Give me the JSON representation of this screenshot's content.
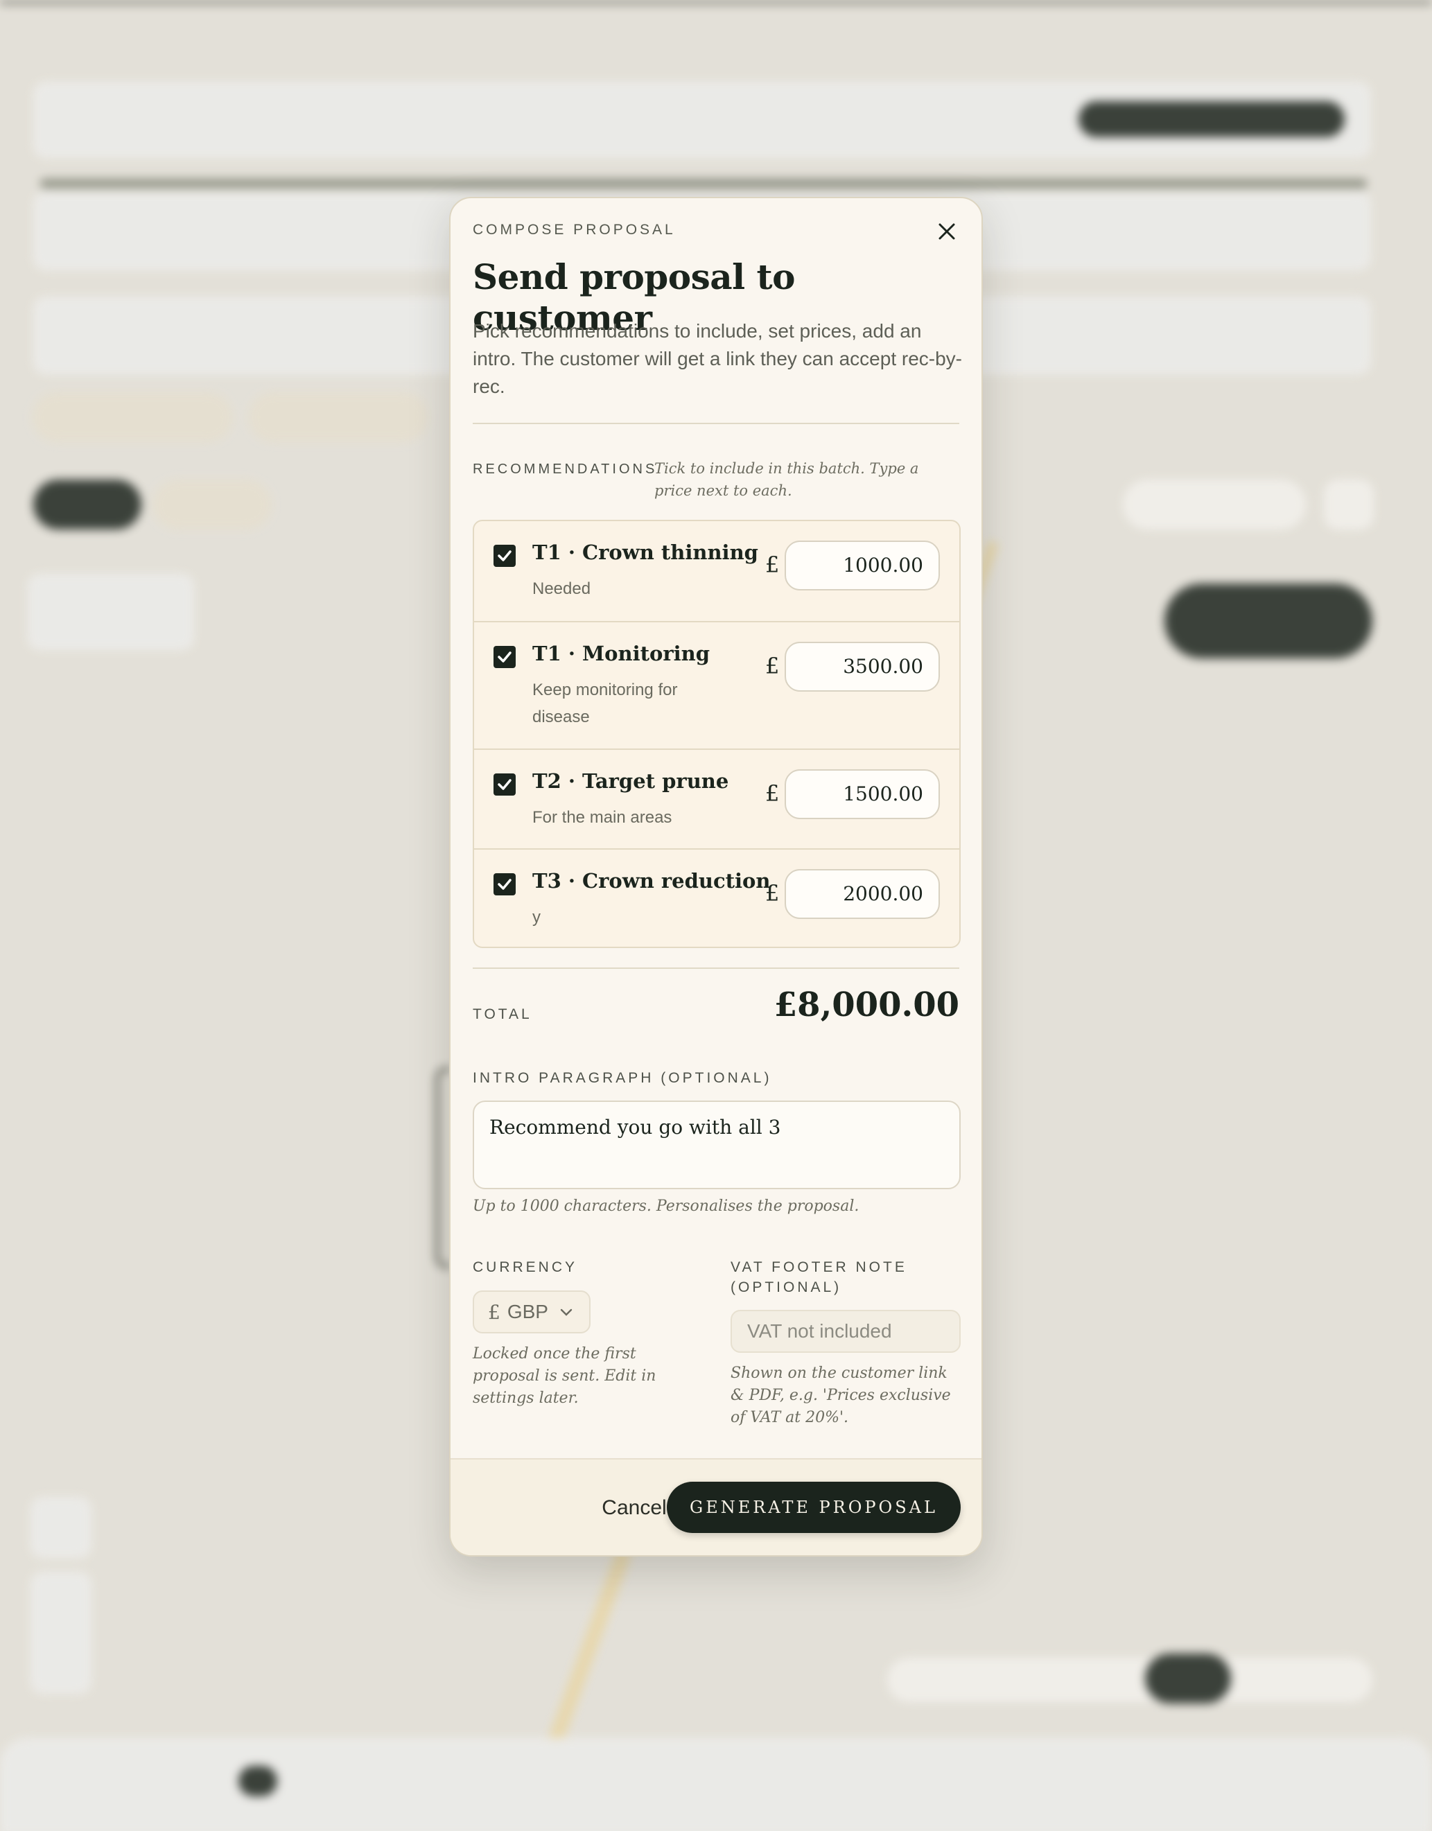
{
  "modal": {
    "eyebrow": "COMPOSE PROPOSAL",
    "title": "Send proposal to customer",
    "description": "Pick recommendations to include, set prices, add an intro. The customer will get a link they can accept rec-by-rec.",
    "close_icon": "close-icon"
  },
  "recommendations": {
    "label": "RECOMMENDATIONS",
    "hint": "Tick to include in this batch. Type a price next to each.",
    "currency_symbol": "£",
    "items": [
      {
        "name": "T1 · Crown thinning",
        "note": "Needed",
        "price": "1000.00",
        "checked": true
      },
      {
        "name": "T1 · Monitoring",
        "note": "Keep monitoring for disease",
        "price": "3500.00",
        "checked": true
      },
      {
        "name": "T2 · Target prune",
        "note": "For the main areas",
        "price": "1500.00",
        "checked": true
      },
      {
        "name": "T3 · Crown reduction",
        "note": "y",
        "price": "2000.00",
        "checked": true
      }
    ]
  },
  "total": {
    "label": "TOTAL",
    "value": "£8,000.00"
  },
  "intro": {
    "label": "INTRO PARAGRAPH (OPTIONAL)",
    "value": "Recommend you go with all 3",
    "hint": "Up to 1000 characters. Personalises the proposal."
  },
  "currency": {
    "label": "CURRENCY",
    "symbol": "£",
    "value": "GBP",
    "hint": "Locked once the first proposal is sent. Edit in settings later."
  },
  "vat": {
    "label": "VAT FOOTER NOTE (OPTIONAL)",
    "placeholder": "VAT not included",
    "hint": "Shown on the customer link & PDF, e.g. 'Prices exclusive of VAT at 20%'."
  },
  "footer": {
    "cancel_label": "Cancel",
    "generate_label": "GENERATE PROPOSAL"
  },
  "colors": {
    "accent": "#1b241d",
    "modal_bg": "#faf6ef",
    "rec_bg": "#fbf3e6"
  }
}
